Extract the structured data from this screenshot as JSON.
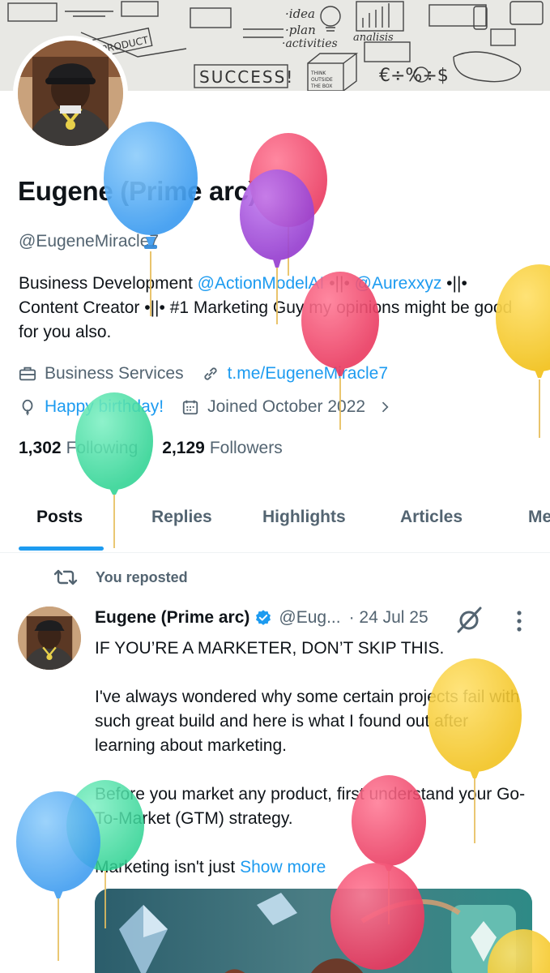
{
  "banner": {
    "words": [
      "SUCCESS!",
      "idea",
      "plan",
      "activities",
      "analisis",
      "THINK OUTSIDE THE BOX",
      "€ ÷ % ÷ $",
      "PRODUCT"
    ]
  },
  "profile": {
    "name": "Eugene (Prime arc)",
    "handle": "@EugeneMiracle7",
    "bio": {
      "prefix": "Business Development ",
      "mention1": "@ActionModelAI",
      "sep1": " •||• ",
      "mention2": "@Aurexxyz",
      "rest": " •||• Content Creator •||• #1 Marketing Guy my opinions might be good for you also."
    },
    "category": "Business Services",
    "website": "t.me/EugeneMiracle7",
    "birthday": "Happy birthday!",
    "joined": "Joined October 2022",
    "following_count": "1,302",
    "following_label": "Following",
    "followers_count": "2,129",
    "followers_label": "Followers"
  },
  "tabs": [
    {
      "label": "Posts",
      "active": true
    },
    {
      "label": "Replies",
      "active": false
    },
    {
      "label": "Highlights",
      "active": false
    },
    {
      "label": "Articles",
      "active": false
    },
    {
      "label": "Me",
      "active": false
    }
  ],
  "post": {
    "repost_label": "You reposted",
    "author_name": "Eugene (Prime arc)",
    "author_handle": "@Eug...",
    "date": "· 24 Jul 25",
    "paragraphs": [
      "IF YOU’RE A MARKETER, DON’T SKIP THIS.",
      "I've always wondered why some certain projects fail with such great build and here is what I found out after learning about marketing.",
      "Before you market any product, first understand your Go-To-Market (GTM) strategy."
    ],
    "truncated_text": "Marketing isn't just ",
    "show_more": "Show more"
  },
  "colors": {
    "accent": "#1d9bf0",
    "text_primary": "#0f1419",
    "text_secondary": "#536471",
    "balloon_blue": "#4aa6f2",
    "balloon_red": "#f0496b",
    "balloon_purple": "#a24fd6",
    "balloon_yellow": "#f5cc2a",
    "balloon_green": "#38d99a"
  },
  "icons": {
    "category": "briefcase-icon",
    "website": "link-icon",
    "birthday": "balloon-icon",
    "joined": "calendar-icon",
    "repost": "repost-icon",
    "verified": "verified-badge-icon",
    "grok": "grok-icon",
    "more": "more-vertical-icon"
  }
}
